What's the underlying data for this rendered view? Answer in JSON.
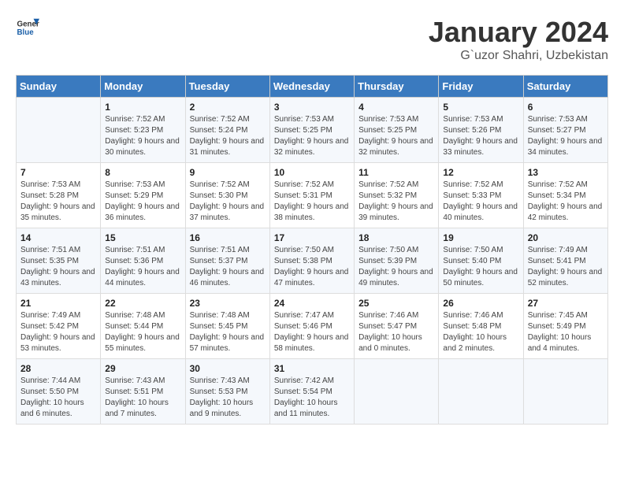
{
  "app": {
    "name_line1": "General",
    "name_line2": "Blue"
  },
  "header": {
    "title": "January 2024",
    "subtitle": "G`uzor Shahri, Uzbekistan"
  },
  "columns": [
    "Sunday",
    "Monday",
    "Tuesday",
    "Wednesday",
    "Thursday",
    "Friday",
    "Saturday"
  ],
  "weeks": [
    [
      {
        "day": "",
        "sunrise": "",
        "sunset": "",
        "daylight": ""
      },
      {
        "day": "1",
        "sunrise": "Sunrise: 7:52 AM",
        "sunset": "Sunset: 5:23 PM",
        "daylight": "Daylight: 9 hours and 30 minutes."
      },
      {
        "day": "2",
        "sunrise": "Sunrise: 7:52 AM",
        "sunset": "Sunset: 5:24 PM",
        "daylight": "Daylight: 9 hours and 31 minutes."
      },
      {
        "day": "3",
        "sunrise": "Sunrise: 7:53 AM",
        "sunset": "Sunset: 5:25 PM",
        "daylight": "Daylight: 9 hours and 32 minutes."
      },
      {
        "day": "4",
        "sunrise": "Sunrise: 7:53 AM",
        "sunset": "Sunset: 5:25 PM",
        "daylight": "Daylight: 9 hours and 32 minutes."
      },
      {
        "day": "5",
        "sunrise": "Sunrise: 7:53 AM",
        "sunset": "Sunset: 5:26 PM",
        "daylight": "Daylight: 9 hours and 33 minutes."
      },
      {
        "day": "6",
        "sunrise": "Sunrise: 7:53 AM",
        "sunset": "Sunset: 5:27 PM",
        "daylight": "Daylight: 9 hours and 34 minutes."
      }
    ],
    [
      {
        "day": "7",
        "sunrise": "Sunrise: 7:53 AM",
        "sunset": "Sunset: 5:28 PM",
        "daylight": "Daylight: 9 hours and 35 minutes."
      },
      {
        "day": "8",
        "sunrise": "Sunrise: 7:53 AM",
        "sunset": "Sunset: 5:29 PM",
        "daylight": "Daylight: 9 hours and 36 minutes."
      },
      {
        "day": "9",
        "sunrise": "Sunrise: 7:52 AM",
        "sunset": "Sunset: 5:30 PM",
        "daylight": "Daylight: 9 hours and 37 minutes."
      },
      {
        "day": "10",
        "sunrise": "Sunrise: 7:52 AM",
        "sunset": "Sunset: 5:31 PM",
        "daylight": "Daylight: 9 hours and 38 minutes."
      },
      {
        "day": "11",
        "sunrise": "Sunrise: 7:52 AM",
        "sunset": "Sunset: 5:32 PM",
        "daylight": "Daylight: 9 hours and 39 minutes."
      },
      {
        "day": "12",
        "sunrise": "Sunrise: 7:52 AM",
        "sunset": "Sunset: 5:33 PM",
        "daylight": "Daylight: 9 hours and 40 minutes."
      },
      {
        "day": "13",
        "sunrise": "Sunrise: 7:52 AM",
        "sunset": "Sunset: 5:34 PM",
        "daylight": "Daylight: 9 hours and 42 minutes."
      }
    ],
    [
      {
        "day": "14",
        "sunrise": "Sunrise: 7:51 AM",
        "sunset": "Sunset: 5:35 PM",
        "daylight": "Daylight: 9 hours and 43 minutes."
      },
      {
        "day": "15",
        "sunrise": "Sunrise: 7:51 AM",
        "sunset": "Sunset: 5:36 PM",
        "daylight": "Daylight: 9 hours and 44 minutes."
      },
      {
        "day": "16",
        "sunrise": "Sunrise: 7:51 AM",
        "sunset": "Sunset: 5:37 PM",
        "daylight": "Daylight: 9 hours and 46 minutes."
      },
      {
        "day": "17",
        "sunrise": "Sunrise: 7:50 AM",
        "sunset": "Sunset: 5:38 PM",
        "daylight": "Daylight: 9 hours and 47 minutes."
      },
      {
        "day": "18",
        "sunrise": "Sunrise: 7:50 AM",
        "sunset": "Sunset: 5:39 PM",
        "daylight": "Daylight: 9 hours and 49 minutes."
      },
      {
        "day": "19",
        "sunrise": "Sunrise: 7:50 AM",
        "sunset": "Sunset: 5:40 PM",
        "daylight": "Daylight: 9 hours and 50 minutes."
      },
      {
        "day": "20",
        "sunrise": "Sunrise: 7:49 AM",
        "sunset": "Sunset: 5:41 PM",
        "daylight": "Daylight: 9 hours and 52 minutes."
      }
    ],
    [
      {
        "day": "21",
        "sunrise": "Sunrise: 7:49 AM",
        "sunset": "Sunset: 5:42 PM",
        "daylight": "Daylight: 9 hours and 53 minutes."
      },
      {
        "day": "22",
        "sunrise": "Sunrise: 7:48 AM",
        "sunset": "Sunset: 5:44 PM",
        "daylight": "Daylight: 9 hours and 55 minutes."
      },
      {
        "day": "23",
        "sunrise": "Sunrise: 7:48 AM",
        "sunset": "Sunset: 5:45 PM",
        "daylight": "Daylight: 9 hours and 57 minutes."
      },
      {
        "day": "24",
        "sunrise": "Sunrise: 7:47 AM",
        "sunset": "Sunset: 5:46 PM",
        "daylight": "Daylight: 9 hours and 58 minutes."
      },
      {
        "day": "25",
        "sunrise": "Sunrise: 7:46 AM",
        "sunset": "Sunset: 5:47 PM",
        "daylight": "Daylight: 10 hours and 0 minutes."
      },
      {
        "day": "26",
        "sunrise": "Sunrise: 7:46 AM",
        "sunset": "Sunset: 5:48 PM",
        "daylight": "Daylight: 10 hours and 2 minutes."
      },
      {
        "day": "27",
        "sunrise": "Sunrise: 7:45 AM",
        "sunset": "Sunset: 5:49 PM",
        "daylight": "Daylight: 10 hours and 4 minutes."
      }
    ],
    [
      {
        "day": "28",
        "sunrise": "Sunrise: 7:44 AM",
        "sunset": "Sunset: 5:50 PM",
        "daylight": "Daylight: 10 hours and 6 minutes."
      },
      {
        "day": "29",
        "sunrise": "Sunrise: 7:43 AM",
        "sunset": "Sunset: 5:51 PM",
        "daylight": "Daylight: 10 hours and 7 minutes."
      },
      {
        "day": "30",
        "sunrise": "Sunrise: 7:43 AM",
        "sunset": "Sunset: 5:53 PM",
        "daylight": "Daylight: 10 hours and 9 minutes."
      },
      {
        "day": "31",
        "sunrise": "Sunrise: 7:42 AM",
        "sunset": "Sunset: 5:54 PM",
        "daylight": "Daylight: 10 hours and 11 minutes."
      },
      {
        "day": "",
        "sunrise": "",
        "sunset": "",
        "daylight": ""
      },
      {
        "day": "",
        "sunrise": "",
        "sunset": "",
        "daylight": ""
      },
      {
        "day": "",
        "sunrise": "",
        "sunset": "",
        "daylight": ""
      }
    ]
  ]
}
